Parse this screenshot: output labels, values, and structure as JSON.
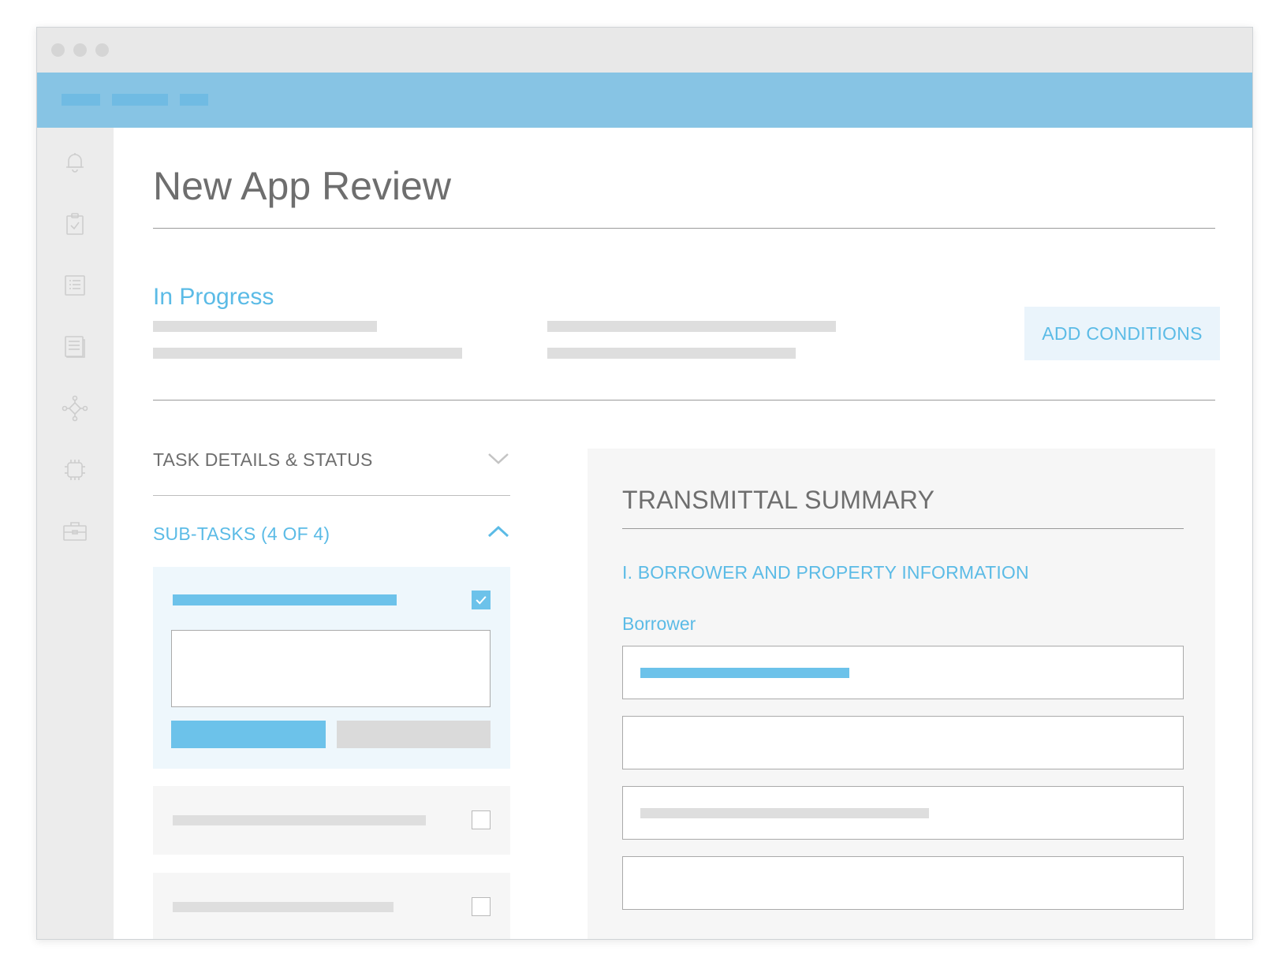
{
  "page": {
    "title": "New App Review",
    "status": "In Progress",
    "add_conditions_label": "ADD CONDITIONS"
  },
  "sidebar": {
    "items": [
      {
        "icon": "bell-icon"
      },
      {
        "icon": "clipboard-check-icon"
      },
      {
        "icon": "list-icon"
      },
      {
        "icon": "document-icon"
      },
      {
        "icon": "network-icon"
      },
      {
        "icon": "chip-icon"
      },
      {
        "icon": "briefcase-icon"
      }
    ]
  },
  "tasks": {
    "details_label": "TASK DETAILS & STATUS",
    "subtasks_label": "SUB-TASKS (4 OF 4)",
    "subtasks": [
      {
        "checked": true
      },
      {
        "checked": false
      },
      {
        "checked": false
      }
    ]
  },
  "summary": {
    "title": "TRANSMITTAL SUMMARY",
    "section": "I. BORROWER AND PROPERTY INFORMATION",
    "field_label": "Borrower"
  },
  "colors": {
    "accent": "#5bbbe6",
    "appbar": "#87c4e4",
    "sidebar": "#ececec",
    "placeholder": "#dedede"
  }
}
